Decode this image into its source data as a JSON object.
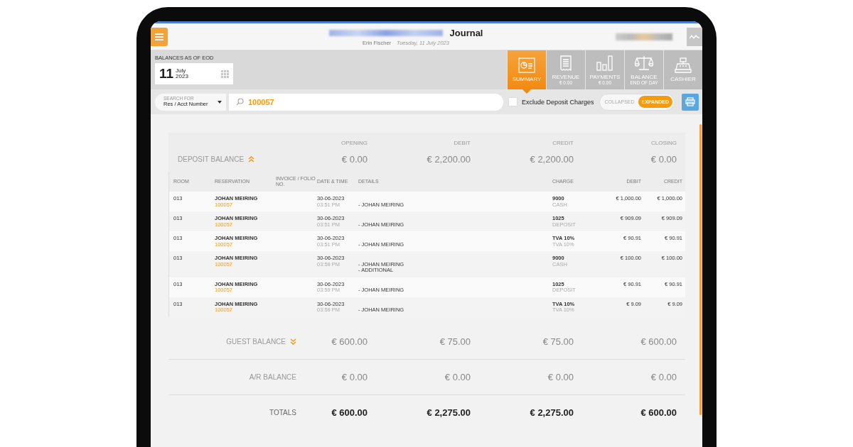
{
  "header": {
    "title": "Journal",
    "user": "Erin Fischer",
    "date": "Tuesday, 11 July 2023"
  },
  "date_panel": {
    "label": "BALANCES AS OF EOD",
    "day": "11",
    "month": "July",
    "year": "2023"
  },
  "tabs": [
    {
      "label": "SUMMARY",
      "selected": true
    },
    {
      "label": "REVENUE",
      "sub": "€ 0.00",
      "selected": false
    },
    {
      "label": "PAYMENTS",
      "sub": "€ 0.00",
      "selected": false
    },
    {
      "label": "BALANCE",
      "sub": "END OF DAY",
      "selected": false
    },
    {
      "label": "CASHIER",
      "selected": false
    }
  ],
  "search": {
    "type_label": "SEARCH FOR",
    "type_value": "Res / Acct Number",
    "value": "100057"
  },
  "exclude_deposit": {
    "label": "Exclude Deposit Charges",
    "checked": false
  },
  "view_toggle": [
    {
      "label": "COLLAPSED",
      "selected": false
    },
    {
      "label": "EXPANDED",
      "selected": true
    }
  ],
  "summary_columns": [
    "OPENING",
    "DEBIT",
    "CREDIT",
    "CLOSING"
  ],
  "sections": [
    {
      "label": "DEPOSIT BALANCE",
      "kind": "balance",
      "expanded": true,
      "values": [
        "€ 0.00",
        "€ 2,200.00",
        "€ 2,200.00",
        "€ 0.00"
      ]
    },
    {
      "label": "GUEST BALANCE",
      "kind": "balance",
      "expanded": false,
      "values": [
        "€ 600.00",
        "€ 75.00",
        "€ 75.00",
        "€ 600.00"
      ]
    },
    {
      "label": "A/R BALANCE",
      "kind": "balance",
      "values": [
        "€ 0.00",
        "€ 0.00",
        "€ 0.00",
        "€ 0.00"
      ]
    },
    {
      "label": "TOTALS",
      "kind": "totals",
      "values": [
        "€ 600.00",
        "€ 2,275.00",
        "€ 2,275.00",
        "€ 600.00"
      ]
    }
  ],
  "transactions": {
    "columns": [
      "ROOM",
      "RESERVATION",
      "INVOICE / FOLIO NO.",
      "DATE & TIME",
      "DETAILS",
      "CHARGE",
      "DEBIT",
      "CREDIT"
    ],
    "rows": [
      {
        "room": "013",
        "guest": "JOHAN MEIRING",
        "reservation": "100057",
        "date": "30-06-2023",
        "time": "03:51 PM",
        "details": [
          "- JOHAN MEIRING"
        ],
        "charge_code": "9000",
        "charge_name": "CASH",
        "debit": "€ 1,000.00",
        "credit": "€ 1,000.00"
      },
      {
        "room": "013",
        "guest": "JOHAN MEIRING",
        "reservation": "100057",
        "date": "30-06-2023",
        "time": "03:51 PM",
        "details": [
          "- JOHAN MEIRING"
        ],
        "charge_code": "1025",
        "charge_name": "DEPOSIT",
        "debit": "€ 909.09",
        "credit": "€ 909.09"
      },
      {
        "room": "013",
        "guest": "JOHAN MEIRING",
        "reservation": "100057",
        "date": "30-06-2023",
        "time": "03:51 PM",
        "details": [
          "- JOHAN MEIRING"
        ],
        "charge_code": "TVA 10%",
        "charge_name": "TVA 10%",
        "debit": "€ 90.91",
        "credit": "€ 90.91"
      },
      {
        "room": "013",
        "guest": "JOHAN MEIRING",
        "reservation": "100057",
        "date": "30-06-2023",
        "time": "03:59 PM",
        "details": [
          "- JOHAN MEIRING",
          "- ADDITIONAL"
        ],
        "charge_code": "9000",
        "charge_name": "CASH",
        "debit": "€ 100.00",
        "credit": "€ 100.00"
      },
      {
        "room": "013",
        "guest": "JOHAN MEIRING",
        "reservation": "100057",
        "date": "30-06-2023",
        "time": "03:59 PM",
        "details": [
          "- JOHAN MEIRING"
        ],
        "charge_code": "1025",
        "charge_name": "DEPOSIT",
        "debit": "€ 90.91",
        "credit": "€ 90.91"
      },
      {
        "room": "013",
        "guest": "JOHAN MEIRING",
        "reservation": "100057",
        "date": "30-06-2023",
        "time": "03:59 PM",
        "details": [
          "- JOHAN MEIRING"
        ],
        "charge_code": "TVA 10%",
        "charge_name": "TVA 10%",
        "debit": "€ 9.09",
        "credit": "€ 9.09"
      }
    ]
  }
}
